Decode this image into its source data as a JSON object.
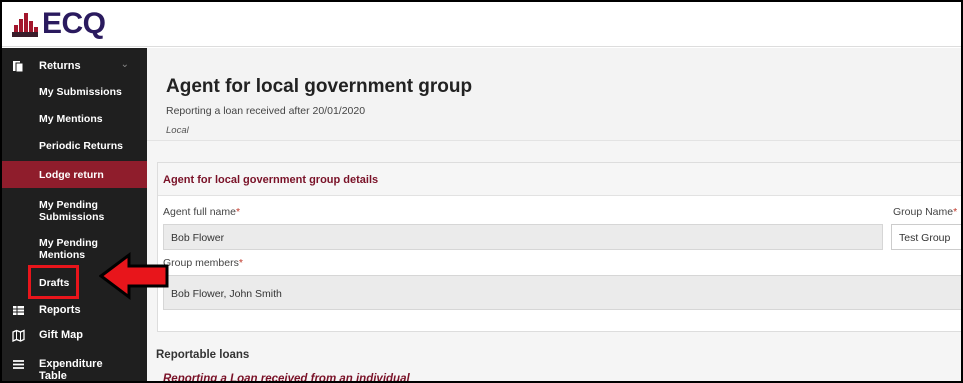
{
  "brand": {
    "name": "ECQ"
  },
  "sidebar": {
    "groups": [
      {
        "label": "Returns",
        "icon": "document-icon",
        "expanded": true
      },
      {
        "label": "Reports",
        "icon": "table-icon"
      },
      {
        "label": "Gift Map",
        "icon": "map-icon"
      },
      {
        "label": "Expenditure Table",
        "icon": "menu-icon"
      }
    ],
    "returns_items": [
      {
        "label": "My Submissions"
      },
      {
        "label": "My Mentions"
      },
      {
        "label": "Periodic Returns"
      },
      {
        "label": "Lodge return",
        "active": true
      },
      {
        "label": "My Pending Submissions"
      },
      {
        "label": "My Pending Mentions"
      },
      {
        "label": "Drafts"
      }
    ]
  },
  "page": {
    "title": "Agent for local government group",
    "subtitle": "Reporting a loan received after 20/01/2020",
    "type": "Local"
  },
  "details_panel": {
    "title": "Agent for local government group details",
    "agent_name_label": "Agent full name",
    "agent_name_value": "Bob Flower",
    "group_name_label": "Group Name",
    "group_name_value": "Test Group",
    "members_label": "Group members",
    "members_value": "Bob Flower, John Smith"
  },
  "loans": {
    "title": "Reportable loans",
    "subtitle": "Reporting a Loan received from an individual"
  },
  "colors": {
    "accent": "#8f1d2c",
    "sidebar": "#1f1f1f",
    "annotation": "#e8151b"
  }
}
